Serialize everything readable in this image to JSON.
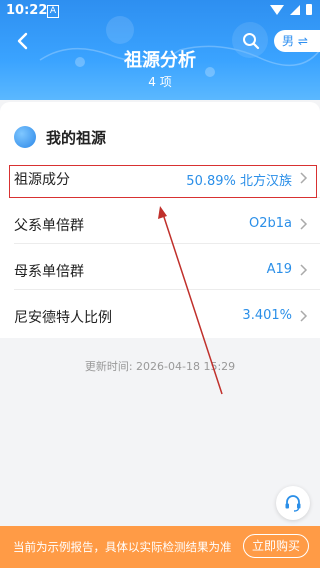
{
  "status_bar": {
    "time": "10:22",
    "notification_glyph": "A"
  },
  "header": {
    "title": "祖源分析",
    "subtitle": "4 项",
    "gender_label": "男 ⇌"
  },
  "section": {
    "title": "我的祖源"
  },
  "rows": [
    {
      "label": "祖源成分",
      "value": "50.89% 北方汉族"
    },
    {
      "label": "父系单倍群",
      "value": "O2b1a"
    },
    {
      "label": "母系单倍群",
      "value": "A19"
    },
    {
      "label": "尼安德特人比例",
      "value": "3.401%"
    }
  ],
  "update_time": "更新时间: 2026-04-18 15:29",
  "bottom_bar": {
    "notice": "当前为示例报告，具体以实际检测结果为准",
    "buy_label": "立即购买"
  },
  "colors": {
    "accent": "#2b8fe8",
    "header": "#3aa3ff",
    "bottom_bar": "#ff9b46",
    "highlight": "#d83131"
  }
}
